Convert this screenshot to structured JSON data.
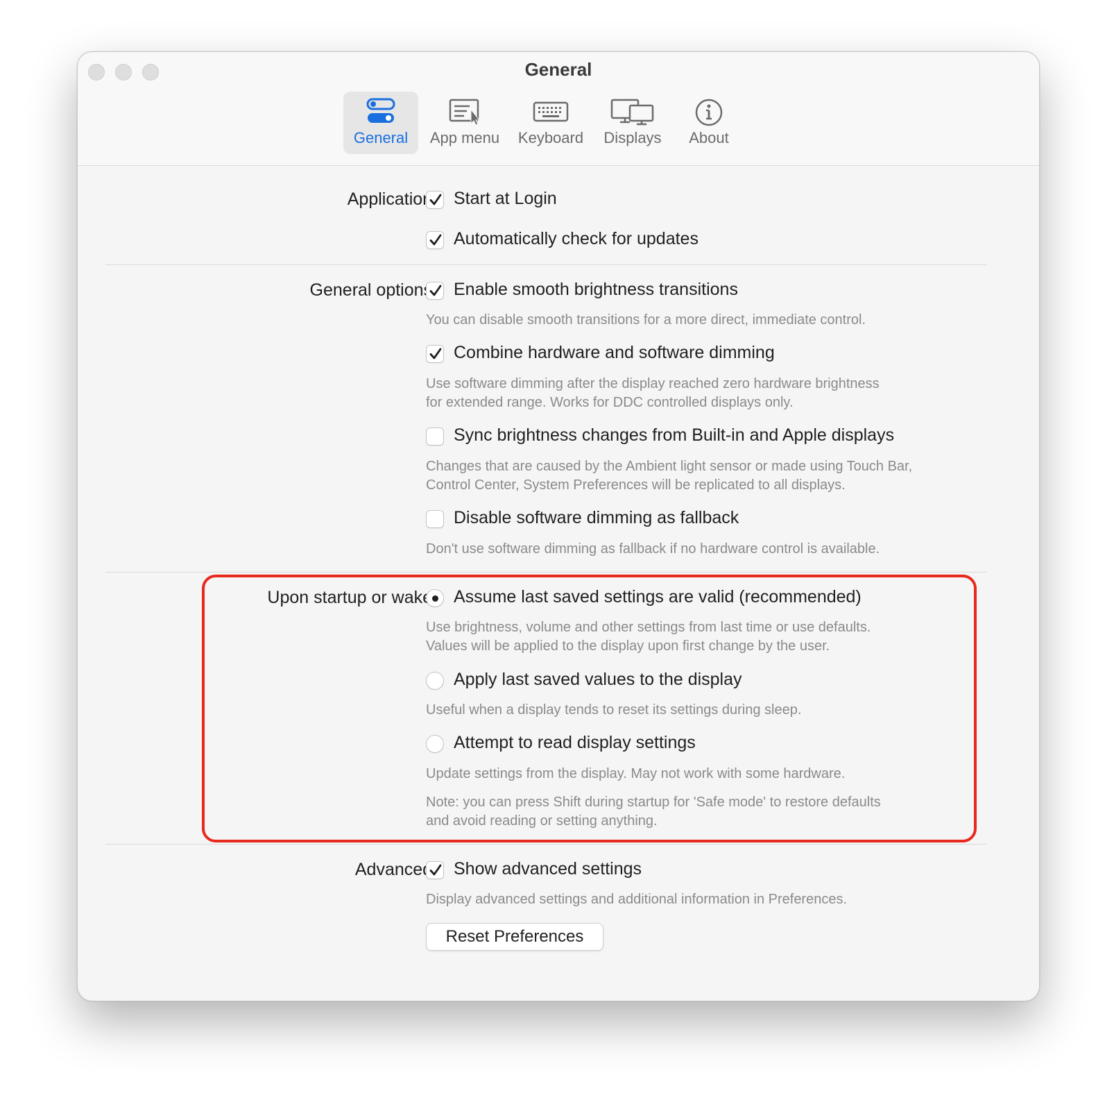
{
  "window": {
    "title": "General"
  },
  "toolbar": {
    "tabs": [
      {
        "label": "General",
        "icon": "toggle-switches-icon",
        "active": true
      },
      {
        "label": "App menu",
        "icon": "app-menu-cursor-icon",
        "active": false
      },
      {
        "label": "Keyboard",
        "icon": "keyboard-icon",
        "active": false
      },
      {
        "label": "Displays",
        "icon": "displays-icon",
        "active": false
      },
      {
        "label": "About",
        "icon": "info-icon",
        "active": false
      }
    ]
  },
  "application": {
    "label": "Application:",
    "start_at_login": {
      "label": "Start at Login",
      "checked": true
    },
    "auto_update": {
      "label": "Automatically check for updates",
      "checked": true
    }
  },
  "general_options": {
    "label": "General options:",
    "smooth": {
      "label": "Enable smooth brightness transitions",
      "checked": true,
      "desc": "You can disable smooth transitions for a more direct, immediate control."
    },
    "combine": {
      "label": "Combine hardware and software dimming",
      "checked": true,
      "desc1": "Use software dimming after the display reached zero hardware brightness",
      "desc2": "for extended range. Works for DDC controlled displays only."
    },
    "sync": {
      "label": "Sync brightness changes from Built-in and Apple displays",
      "checked": false,
      "desc1": "Changes that are caused by the Ambient light sensor or made using Touch Bar,",
      "desc2": "Control Center, System Preferences will be replicated to all displays."
    },
    "disable_fallback": {
      "label": "Disable software dimming as fallback",
      "checked": false,
      "desc": "Don't use software dimming as fallback if no hardware control is available."
    }
  },
  "startup": {
    "label": "Upon startup or wake:",
    "assume": {
      "label": "Assume last saved settings are valid (recommended)",
      "selected": true,
      "desc1": "Use brightness, volume and other settings from last time or use defaults.",
      "desc2": "Values will be applied to the display upon first change by the user."
    },
    "apply": {
      "label": "Apply last saved values to the display",
      "selected": false,
      "desc": "Useful when a display tends to reset its settings during sleep."
    },
    "attempt": {
      "label": "Attempt to read display settings",
      "selected": false,
      "desc": "Update settings from the display. May not work with some hardware."
    },
    "note1": "Note: you can press Shift during startup for 'Safe mode' to restore defaults",
    "note2": "and avoid reading or setting anything."
  },
  "advanced": {
    "label": "Advanced:",
    "show_advanced": {
      "label": "Show advanced settings",
      "checked": true,
      "desc": "Display advanced settings and additional information in Preferences."
    },
    "reset_button": "Reset Preferences"
  },
  "colors": {
    "accent": "#1a6fe0",
    "highlight_border": "#e8291d"
  }
}
